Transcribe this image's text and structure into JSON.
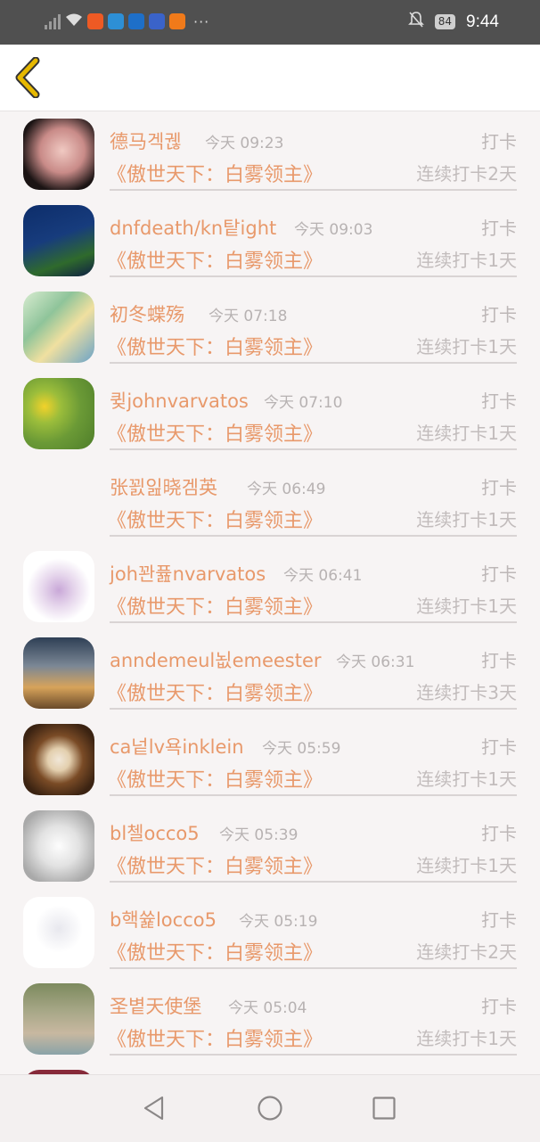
{
  "status_bar": {
    "time": "9:44",
    "battery": "84",
    "overflow": "···",
    "icons": [
      "no-sim-signal-icon",
      "wifi-icon",
      "app-icon-orange",
      "app-icon-blue",
      "app-icon-circle",
      "app-icon-box",
      "app-icon-cat",
      "bell-off-icon",
      "battery-icon"
    ]
  },
  "header": {
    "back_icon": "chevron-left-icon",
    "accent": "#e6b800"
  },
  "colors": {
    "name": "#e8996b",
    "time": "#b7b2b2",
    "streak": "#c2bcbc"
  },
  "list": [
    {
      "name": "德马겍궪",
      "time": "今天 09:23",
      "checkin": "打卡",
      "book": "《傲世天下：白雾领主》",
      "streak": "连续打卡2天"
    },
    {
      "name": "dnfdeath/kn탙ight",
      "time": "今天 09:03",
      "checkin": "打卡",
      "book": "《傲世天下：白雾领主》",
      "streak": "连续打卡1天"
    },
    {
      "name": "初冬蝶殇",
      "time": "今天 07:18",
      "checkin": "打卡",
      "book": "《傲世天下：白雾领主》",
      "streak": "连续打卡1天"
    },
    {
      "name": "큊johnvarvatos",
      "time": "今天 07:10",
      "checkin": "打卡",
      "book": "《傲世天下：白雾领主》",
      "streak": "连续打卡1天"
    },
    {
      "name": "张꾌잂晓겜英",
      "time": "今天 06:49",
      "checkin": "打卡",
      "book": "《傲世天下：白雾领主》",
      "streak": "连续打卡1天"
    },
    {
      "name": "joh꽌퓶nvarvatos",
      "time": "今天 06:41",
      "checkin": "打卡",
      "book": "《傲世天下：白雾领主》",
      "streak": "连续打卡1天"
    },
    {
      "name": "anndemeul뇞emeester",
      "time": "今天 06:31",
      "checkin": "打卡",
      "book": "《傲世天下：白雾领主》",
      "streak": "连续打卡3天"
    },
    {
      "name": "ca넡lv욕inklein",
      "time": "今天 05:59",
      "checkin": "打卡",
      "book": "《傲世天下：白雾领主》",
      "streak": "连续打卡1天"
    },
    {
      "name": "bl첼occo5",
      "time": "今天 05:39",
      "checkin": "打卡",
      "book": "《傲世天下：白雾领主》",
      "streak": "连续打卡1天"
    },
    {
      "name": "b핵쓡locco5",
      "time": "今天 05:19",
      "checkin": "打卡",
      "book": "《傲世天下：白雾领主》",
      "streak": "连续打卡2天"
    },
    {
      "name": "圣볕天使堡",
      "time": "今天 05:04",
      "checkin": "打卡",
      "book": "《傲世天下：白雾领主》",
      "streak": "连续打卡1天"
    }
  ],
  "nav_bar": {
    "icons": [
      "back-triangle-icon",
      "home-circle-icon",
      "recents-square-icon"
    ]
  }
}
